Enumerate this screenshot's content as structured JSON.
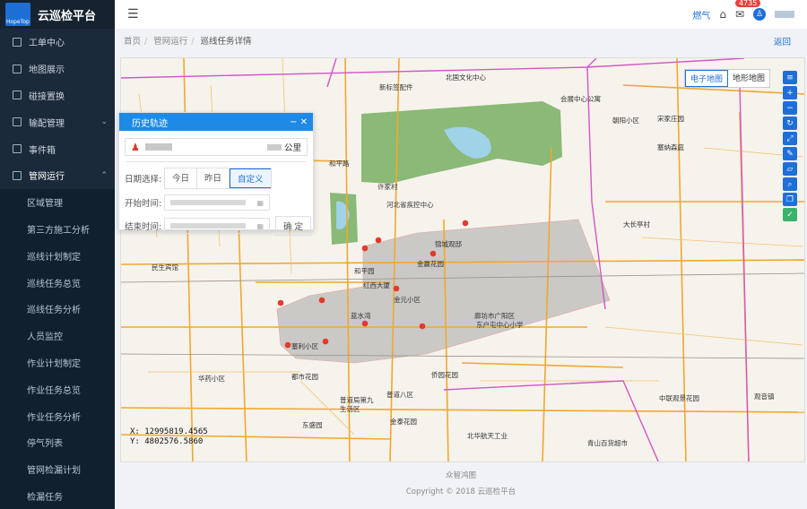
{
  "app": {
    "logo_small": "HopeTop",
    "title": "云巡检平台"
  },
  "sidebar": {
    "items": [
      {
        "label": "工单中心",
        "type": "parent"
      },
      {
        "label": "地图展示",
        "type": "parent"
      },
      {
        "label": "碰接置换",
        "type": "parent"
      },
      {
        "label": "输配管理",
        "type": "parent",
        "chevron": "⌄"
      },
      {
        "label": "事件箱",
        "type": "parent"
      },
      {
        "label": "管网运行",
        "type": "active-parent",
        "chevron": "⌃"
      },
      {
        "label": "区域管理",
        "type": "sub"
      },
      {
        "label": "第三方施工分析",
        "type": "sub"
      },
      {
        "label": "巡线计划制定",
        "type": "sub"
      },
      {
        "label": "巡线任务总览",
        "type": "sub"
      },
      {
        "label": "巡线任务分析",
        "type": "sub"
      },
      {
        "label": "人员监控",
        "type": "sub"
      },
      {
        "label": "作业计划制定",
        "type": "sub"
      },
      {
        "label": "作业任务总览",
        "type": "sub"
      },
      {
        "label": "作业任务分析",
        "type": "sub"
      },
      {
        "label": "停气列表",
        "type": "sub"
      },
      {
        "label": "管网检漏计划",
        "type": "sub"
      },
      {
        "label": "检漏任务",
        "type": "sub"
      }
    ]
  },
  "topbar": {
    "gas_label": "燃气",
    "mail_count": "4735"
  },
  "breadcrumb": [
    "首页",
    "管网运行",
    "巡线任务详情"
  ],
  "back_label": "返回",
  "map": {
    "type_tabs": [
      "电子地图",
      "地形地图"
    ],
    "coords": {
      "x": "X: 12995819.4565",
      "y": "Y: 4802576.5860"
    },
    "labels": [
      "新标签配件",
      "北国文化中心",
      "会展中心公寓",
      "朝阳小区",
      "宋家庄园",
      "塞纳森庭",
      "和平路",
      "许家村",
      "河北省疾控中心",
      "大长亭村",
      "民生宾馆",
      "金赢花园",
      "锦城观邸",
      "和平园",
      "红西大厦",
      "金元小区",
      "蓝水湾",
      "塞利小区",
      "华药小区",
      "都市花园",
      "廊坊市广阳区东户屯中心小学",
      "侨园花园",
      "普道局第九生活区",
      "普道八区",
      "金泰花园",
      "东盛园",
      "北华航天工业学院",
      "中联观景花园",
      "青山百货超市",
      "观音镇"
    ]
  },
  "panel": {
    "title": "历史轨迹",
    "ctrl": "− ✕",
    "distance_unit": "公里",
    "date_label": "日期选择:",
    "date_options": [
      "今日",
      "昨日",
      "自定义"
    ],
    "start_label": "开始时间:",
    "end_label": "结束时间:",
    "confirm_label": "确 定"
  },
  "footer": {
    "line1": "众智鸿图",
    "line2": "Copyright © 2018 云巡检平台"
  }
}
